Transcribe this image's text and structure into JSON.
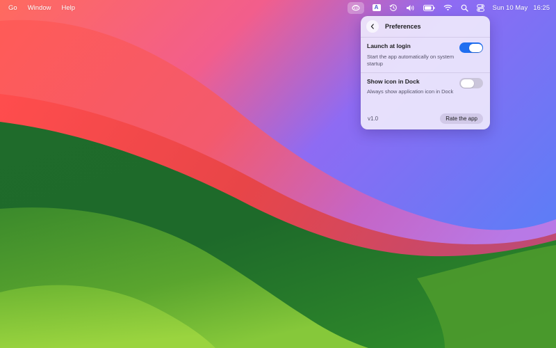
{
  "menubar": {
    "menus": [
      "Go",
      "Window",
      "Help"
    ],
    "status_icons": [
      "app-status-icon",
      "input-source-icon",
      "time-machine-icon",
      "volume-icon",
      "battery-icon",
      "wifi-icon",
      "search-icon",
      "control-center-icon"
    ],
    "input_source_label": "A",
    "date": "Sun 10 May",
    "time": "16:25"
  },
  "popover": {
    "title": "Preferences",
    "settings": [
      {
        "label": "Launch at login",
        "description": "Start the app automatically on system startup",
        "enabled": true
      },
      {
        "label": "Show icon in Dock",
        "description": "Always show application icon in Dock",
        "enabled": false
      }
    ],
    "version": "v1.0",
    "rate_label": "Rate the app"
  },
  "colors": {
    "toggle_on": "#1f6ef0",
    "toggle_off": "#c8c3d7",
    "popover_bg": "#eee8fc"
  }
}
